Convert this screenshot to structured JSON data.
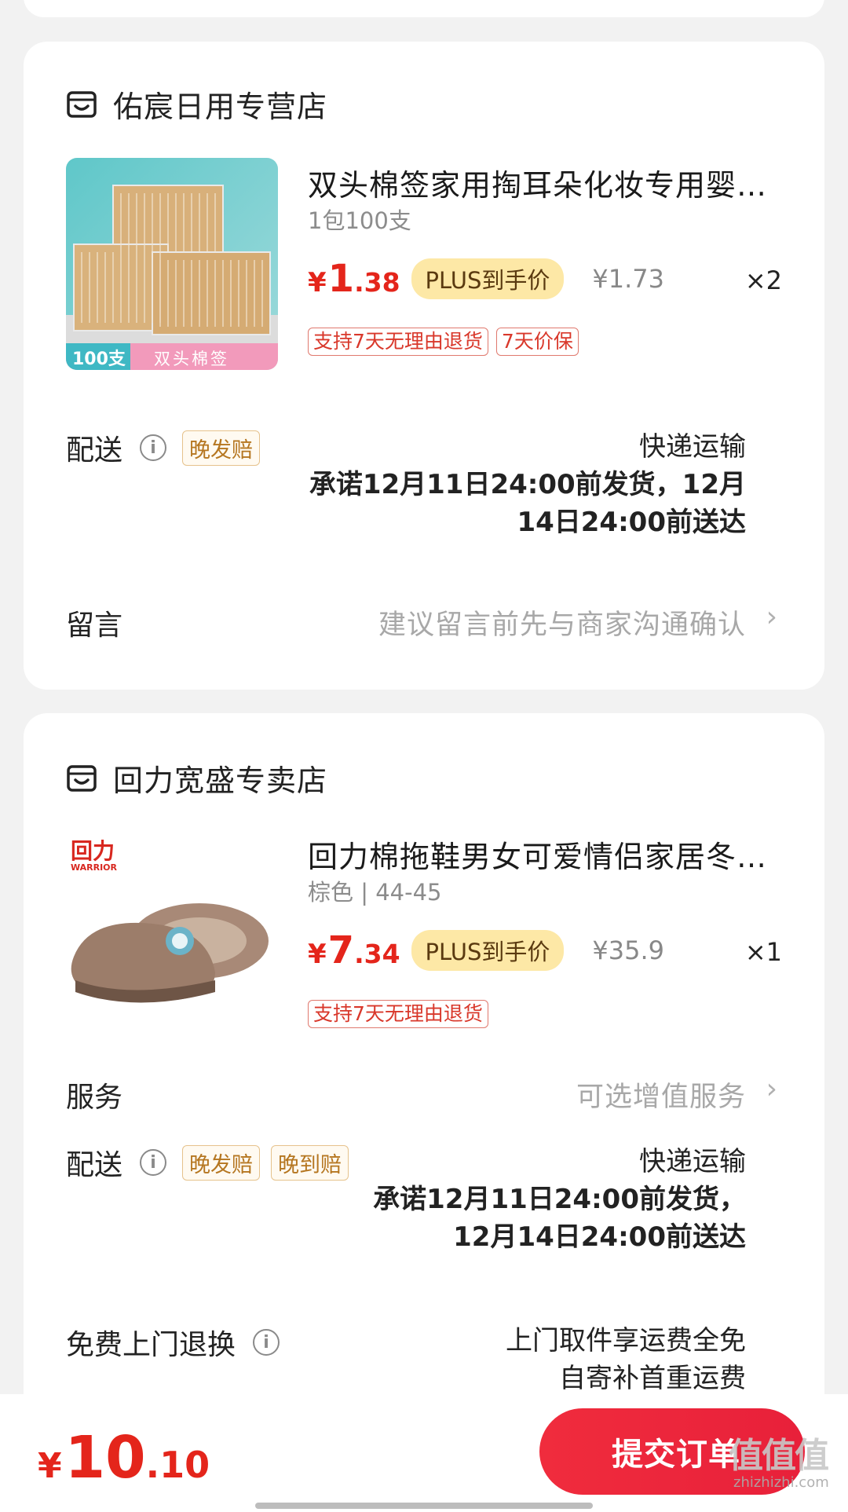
{
  "stores": [
    {
      "name": "佑宸日用专营店",
      "product": {
        "title": "双头棉签家用掏耳朵化妆专用婴儿消毒棉签",
        "spec": "1包100支",
        "price_currency": "¥",
        "price_int": "1",
        "price_dec": ".38",
        "plus_label": "PLUS到手价",
        "original_price": "¥1.73",
        "quantity": "×2",
        "tags": [
          "支持7天无理由退货",
          "7天价保"
        ],
        "thumb_labels": [
          "100支",
          "双头棉签"
        ]
      },
      "delivery": {
        "label": "配送",
        "tag": "晚发赔",
        "method": "快递运输",
        "promise_line1": "承诺12月11日24:00前发货，12月",
        "promise_line2": "14日24:00前送达"
      },
      "message": {
        "label": "留言",
        "placeholder": "建议留言前先与商家沟通确认"
      }
    },
    {
      "name": "回力宽盛专卖店",
      "product": {
        "title": "回力棉拖鞋男女可爱情侣家居冬季保暖拖鞋",
        "spec": "棕色 | 44-45",
        "price_currency": "¥",
        "price_int": "7",
        "price_dec": ".34",
        "plus_label": "PLUS到手价",
        "original_price": "¥35.9",
        "quantity": "×1",
        "tags": [
          "支持7天无理由退货"
        ],
        "brand_logo": "回力",
        "brand_logo_sub": "WARRIOR"
      },
      "service": {
        "label": "服务",
        "value": "可选增值服务"
      },
      "delivery": {
        "label": "配送",
        "tags": [
          "晚发赔",
          "晚到赔"
        ],
        "method": "快递运输",
        "promise_line1": "承诺12月11日24:00前发货，",
        "promise_line2": "12月14日24:00前送达"
      },
      "free_return": {
        "label": "免费上门退换",
        "line1": "上门取件享运费全免",
        "line2": "自寄补首重运费"
      }
    }
  ],
  "footer": {
    "total_currency": "¥",
    "total_int": "10",
    "total_dec": ".10",
    "submit_label": "提交订单",
    "watermark": "值值值",
    "watermark_sub": "zhizhizhi.com"
  },
  "colors": {
    "price_red": "#e4251b",
    "plus_badge_bg": "#fde8a6",
    "submit_button": "#f02c3d",
    "page_bg": "#f2f2f2"
  }
}
